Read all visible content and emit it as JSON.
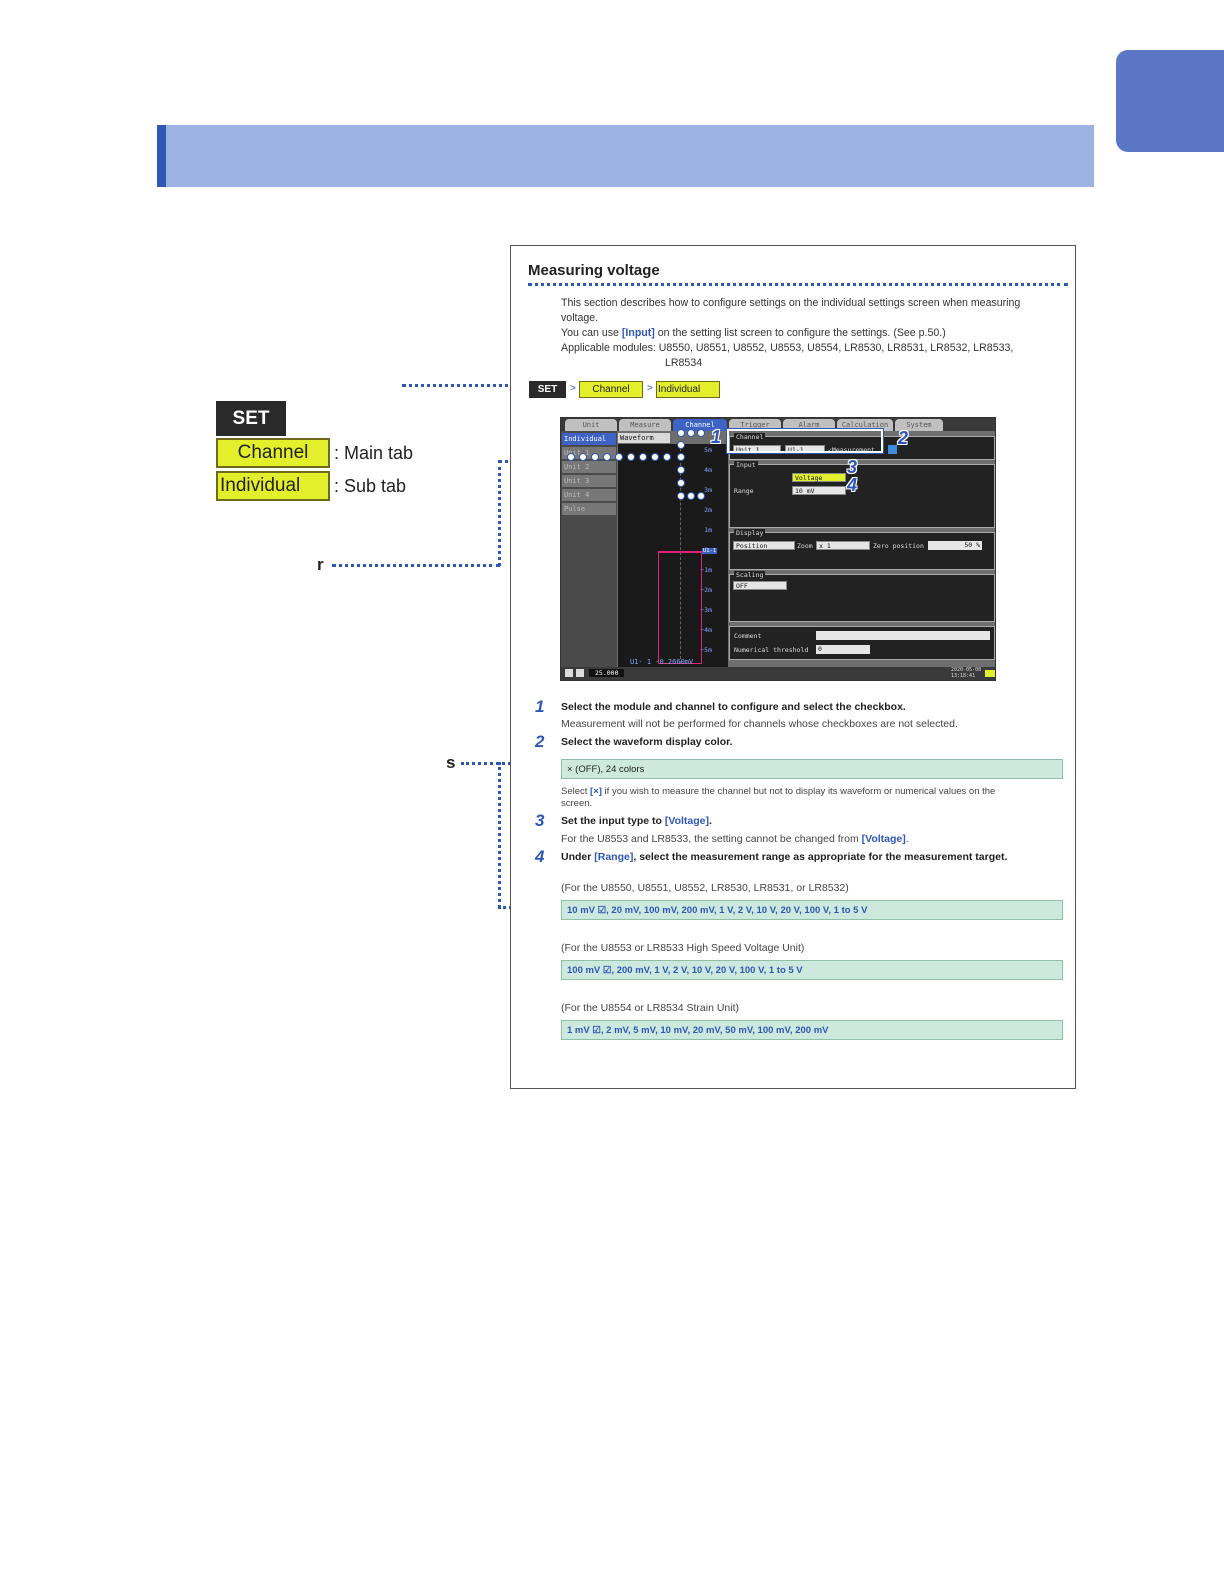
{
  "legend": {
    "set_label": "SET",
    "main_tab_chip": "Channel",
    "main_tab_text": ": Main tab",
    "sub_tab_chip": "Individual",
    "sub_tab_text": ": Sub tab"
  },
  "side_letters": {
    "r": "r",
    "s": "s"
  },
  "card": {
    "title": "Measuring voltage",
    "intro_1": "This section describes how to configure settings on the individual settings screen when measuring",
    "intro_2": "voltage.",
    "intro_3a": "You can use ",
    "intro_3_link": "[Input]",
    "intro_3b": " on the setting list screen to configure the settings. (See p.50.)",
    "modules_1": "Applicable modules: U8550, U8551, U8552, U8553, U8554, LR8530, LR8531, LR8532, LR8533,",
    "modules_2": "LR8534",
    "path_set": "SET",
    "path_sep": ">",
    "path_channel": "Channel",
    "path_individual": "Individual"
  },
  "screen": {
    "tabs": [
      "Unit",
      "Measure",
      "Channel",
      "Trigger",
      "Alarm",
      "Calculation",
      "System"
    ],
    "subnav": [
      "Individual",
      "Unit 1",
      "Unit 2",
      "Unit 3",
      "Unit 4",
      "Pulse"
    ],
    "waveform_label": "Waveform",
    "y_ticks": [
      "5m",
      "4m",
      "3m",
      "2m",
      "1m",
      "0m",
      "−1m",
      "−2m",
      "−3m",
      "−4m",
      "−5m"
    ],
    "readout": "U1- 1 -0.2660mV",
    "marker": "U1-1",
    "channel_panel": "Channel",
    "unit_select": "Unit 1",
    "channel_select": "U1-1",
    "measurement_check": "✓Measurement",
    "input_panel": "Input",
    "input_type": "Voltage",
    "range_label": "Range",
    "range_value": "10 mV",
    "display_panel": "Display",
    "display_mode": "Position",
    "zoom_label": "Zoom",
    "zoom_value": "x 1",
    "zero_label": "Zero position",
    "zero_value": "50 %",
    "scaling_panel": "Scaling",
    "scaling_value": "OFF",
    "comment_label": "Comment",
    "threshold_label": "Numerical threshold",
    "threshold_value": "0",
    "status_value": "25.000",
    "status_date": "2020-05-08",
    "status_time": "13:18:41",
    "colors": {
      "accent": "#3e63c4",
      "wave": "#e0227a",
      "chip": "#e3ef2a",
      "swatch": "#3c8ce0"
    }
  },
  "steps": [
    {
      "num": "1",
      "bold": "Select the module and channel to configure and select the checkbox.",
      "note": "Measurement will not be performed for channels whose checkboxes are not selected."
    },
    {
      "num": "2",
      "bold": "Select the waveform display color."
    },
    {
      "num": "3",
      "bold_a": "Set the input type to ",
      "bold_link": "[Voltage]",
      "bold_b": ".",
      "note_a": "For the U8553 and LR8533, the setting cannot be changed from ",
      "note_link": "[Voltage]",
      "note_b": "."
    },
    {
      "num": "4",
      "bold_a": "Under ",
      "bold_link": "[Range]",
      "bold_b": ", select the measurement range as appropriate for the measurement target."
    }
  ],
  "color_box": "× (OFF), 24 colors",
  "color_note_a": "Select ",
  "color_note_link": "[×]",
  "color_note_b": " if you wish to measure the channel but not to display its waveform or numerical values on the",
  "color_note_c": "screen.",
  "ranges": [
    {
      "caption": "(For the U8550, U8551, U8552, LR8530, LR8531, or LR8532)",
      "values": "10 mV ☑, 20 mV, 100 mV, 200 mV, 1 V, 2 V, 10 V, 20 V, 100 V, 1 to 5 V"
    },
    {
      "caption": "(For the U8553 or LR8533 High Speed Voltage Unit)",
      "values": "100 mV ☑, 200 mV, 1 V, 2 V, 10 V, 20 V, 100 V, 1 to 5 V"
    },
    {
      "caption": "(For the U8554 or LR8534 Strain Unit)",
      "values": "1 mV ☑, 2 mV, 5 mV, 10 mV, 20 mV, 50 mV, 100 mV, 200 mV"
    }
  ]
}
